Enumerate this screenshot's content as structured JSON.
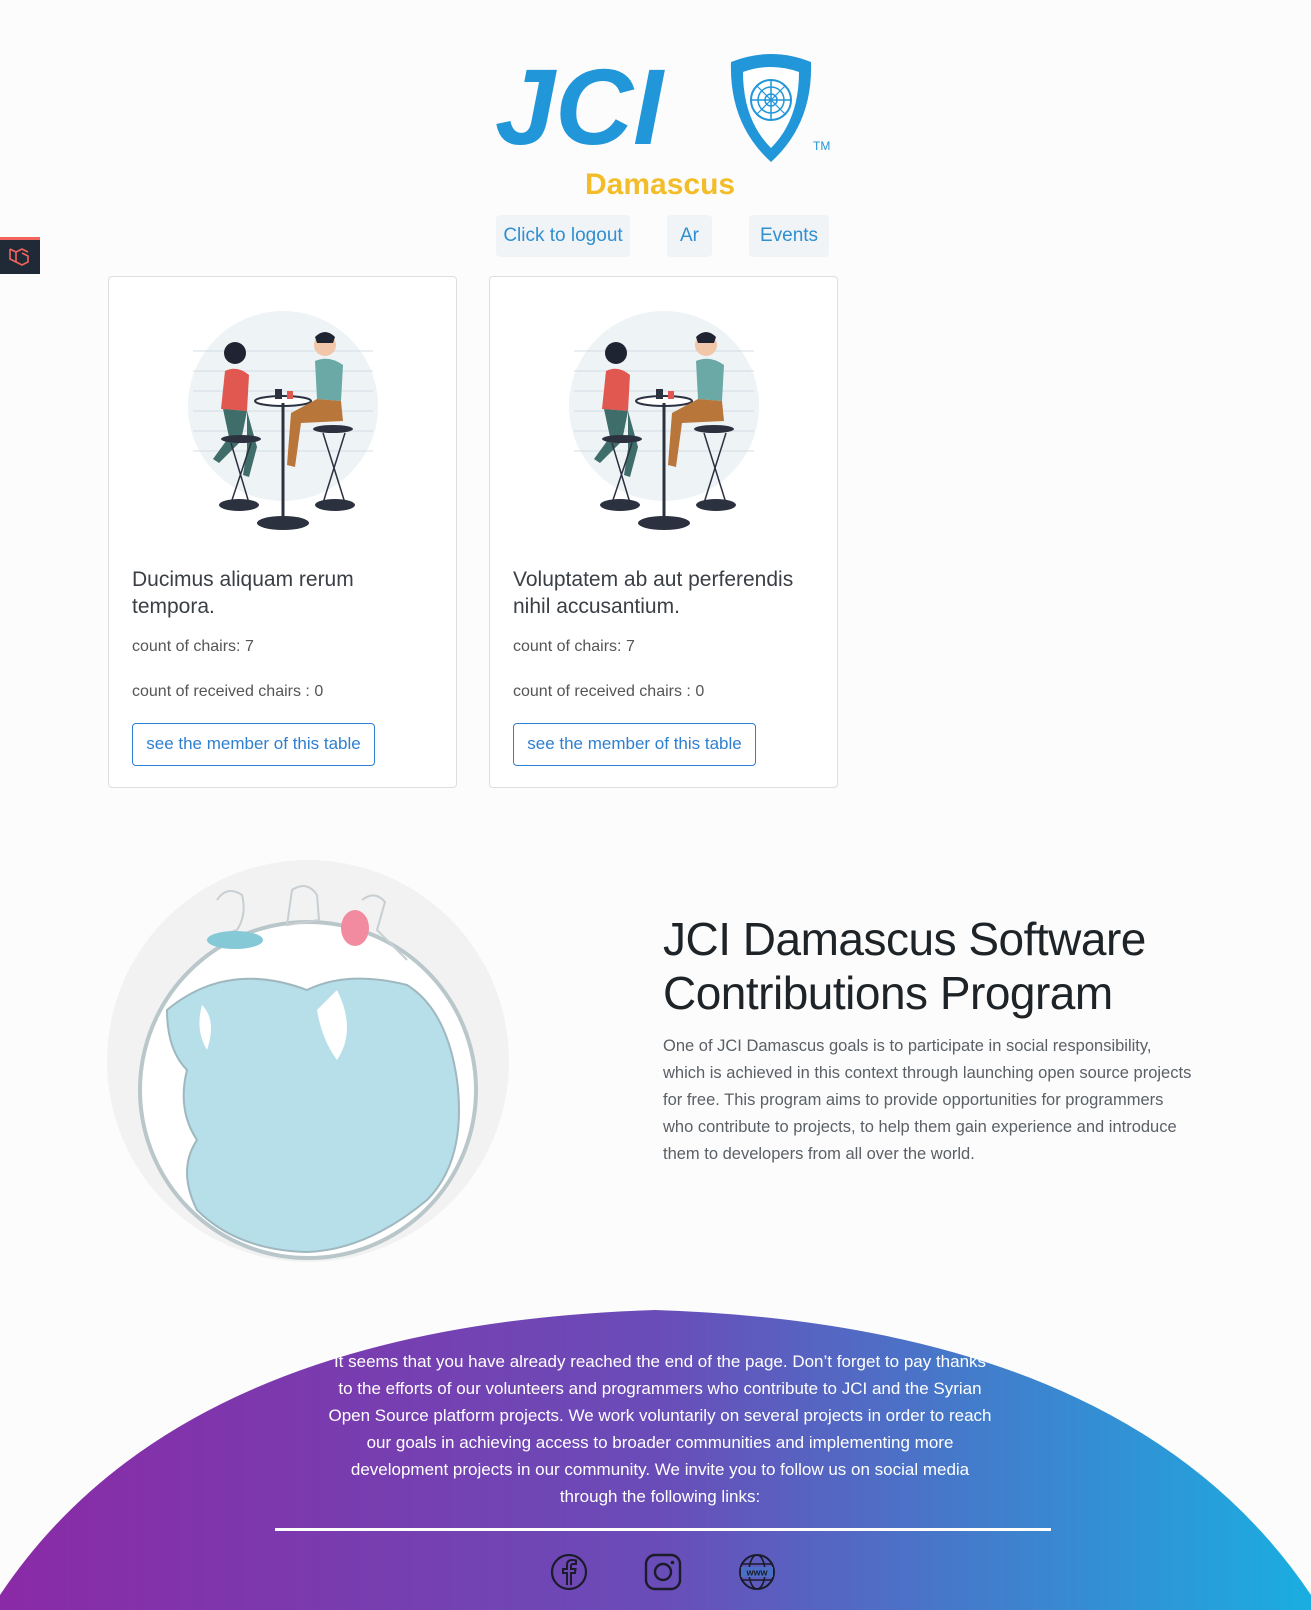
{
  "brand": {
    "logo_text": "JCI",
    "logo_subtext": "Damascus",
    "trademark": "TM",
    "colors": {
      "blue": "#2196d9",
      "yellow": "#f3bd2a"
    }
  },
  "nav": {
    "logout_label": "Click to logout",
    "language_label": "Ar",
    "events_label": "Events"
  },
  "tables": [
    {
      "title": "Ducimus aliquam rerum tempora.",
      "chairs": "count of chairs: 7",
      "received": "count of received chairs : 0",
      "button_label": "see the member of this table"
    },
    {
      "title": "Voluptatem ab aut perferendis nihil accusantium.",
      "chairs": "count of chairs: 7",
      "received": "count of received chairs : 0",
      "button_label": "see the member of this table"
    }
  ],
  "program": {
    "title": "JCI Damascus Software Contributions Program",
    "description": "One of JCI Damascus goals is to participate in social responsibility, which is achieved in this context through launching open source projects for free. This program aims to provide opportunities for programmers who contribute to projects, to help them gain experience and introduce them to developers from all over the world."
  },
  "footer": {
    "text": "It seems that you have already reached the end of the page. Don’t forget to pay thanks to the efforts of our volunteers and programmers who contribute to JCI and the Syrian Open Source platform projects. We work voluntarily on several projects in order to reach our goals in achieving access to broader communities and implementing more development projects in our community. We invite you to follow us on social media through the following links:",
    "gradient": {
      "start": "#8a2aa6",
      "mid": "#6a4cb8",
      "end": "#1aaee0"
    },
    "social_icons": [
      "facebook-icon",
      "instagram-icon",
      "website-icon"
    ]
  }
}
